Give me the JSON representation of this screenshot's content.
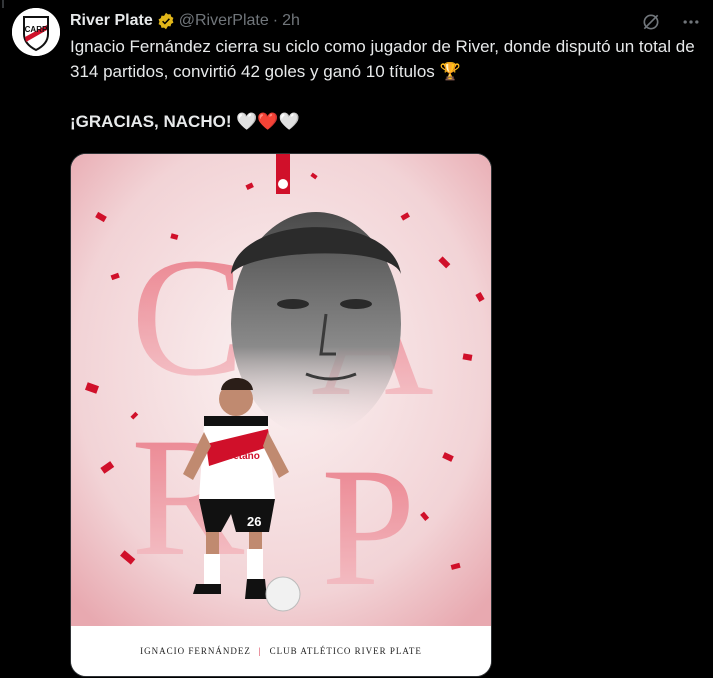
{
  "tweet": {
    "account_name": "River Plate",
    "handle": "@RiverPlate",
    "separator": "·",
    "time": "2h",
    "text_line1": "Ignacio Fernández cierra su ciclo como jugador de River, donde disputó un total de 314 partidos, convirtió 42 goles y ganó 10 títulos 🏆",
    "text_line2": "¡GRACIAS, NACHO! 🤍❤️🤍"
  },
  "media": {
    "big_letters": [
      "C",
      "A",
      "R",
      "P"
    ],
    "shirt_number": "26",
    "sponsor": "Betano",
    "caption_left": "Ignacio Fernández",
    "caption_sep": "|",
    "caption_right": "Club Atlético River Plate"
  },
  "colors": {
    "background": "#000000",
    "text": "#e7e9ea",
    "muted": "#71767b",
    "verified_gold": "#e2b719",
    "river_red": "#d0102a"
  }
}
